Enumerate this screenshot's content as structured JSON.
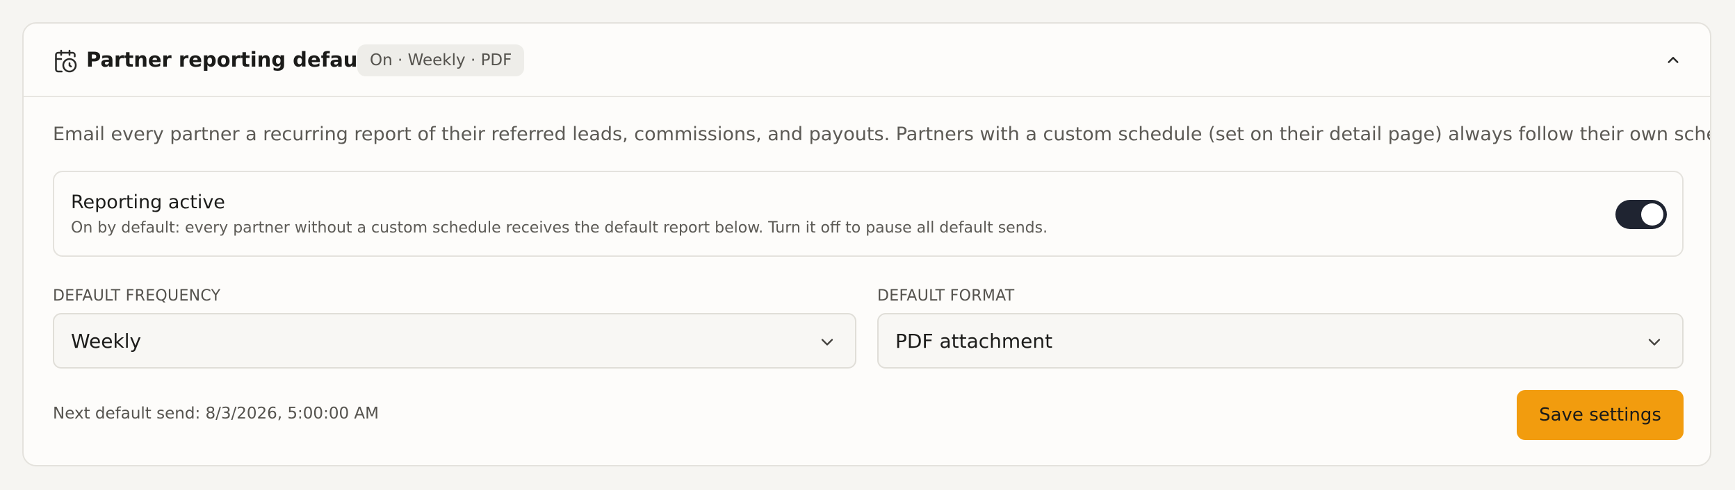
{
  "header": {
    "title": "Partner reporting defaults",
    "badge": "On · Weekly · PDF",
    "icon": "calendar-clock-icon",
    "collapse_icon": "chevron-up-icon"
  },
  "description": "Email every partner a recurring report of their referred leads, commissions, and payouts. Partners with a custom schedule (set on their detail page) always follow their own schedule.",
  "reporting": {
    "title": "Reporting active",
    "subtitle": "On by default: every partner without a custom schedule receives the default report below. Turn it off to pause all default sends.",
    "enabled": true
  },
  "frequency": {
    "label": "DEFAULT FREQUENCY",
    "value": "Weekly"
  },
  "format": {
    "label": "DEFAULT FORMAT",
    "value": "PDF attachment"
  },
  "footer": {
    "next_send": "Next default send: 8/3/2026, 5:00:00 AM",
    "save_label": "Save settings"
  },
  "colors": {
    "accent": "#f29c0e",
    "toggle_on": "#1f2431",
    "background": "#f6f5f2",
    "card": "#fdfcfa"
  }
}
